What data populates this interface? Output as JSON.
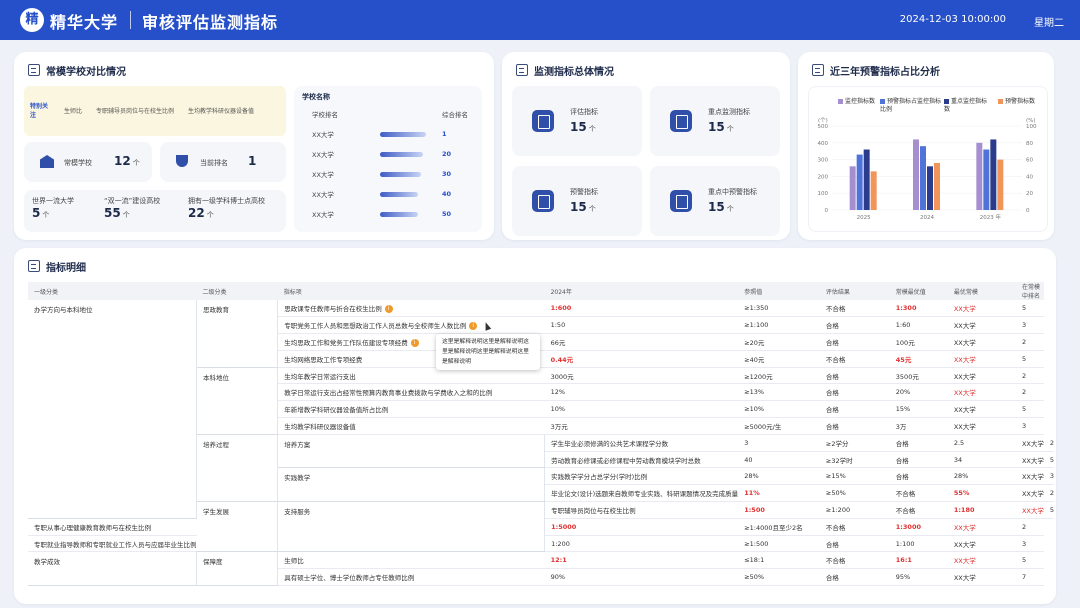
{
  "header": {
    "logo": "精",
    "university": "精华大学",
    "title": "审核评估监测指标",
    "datetime": "2024-12-03 10:00:00",
    "weekday": "星期二"
  },
  "compare": {
    "title": "常模学校对比情况",
    "tags": [
      "特别关注",
      "生师比",
      "专职辅导员岗位与在校生比例",
      "生均教学科研仪器设备值"
    ],
    "norm_label": "常模学校",
    "norm_value": "12",
    "norm_unit": "个",
    "rank_label": "当前排名",
    "rank_value": "1",
    "stats": [
      {
        "label": "世界一流大学",
        "value": "5",
        "unit": "个"
      },
      {
        "label": "“双一流”建设高校",
        "value": "55",
        "unit": "个"
      },
      {
        "label": "拥有一级学科博士点高校",
        "value": "22",
        "unit": "个"
      }
    ],
    "school_title": "学校名称",
    "rank_headers": [
      "学校排名",
      "综合排名"
    ],
    "rank_rows": [
      {
        "name": "XX大学",
        "score": 0.95,
        "rank": "1"
      },
      {
        "name": "XX大学",
        "score": 0.9,
        "rank": "20"
      },
      {
        "name": "XX大学",
        "score": 0.85,
        "rank": "30"
      },
      {
        "name": "XX大学",
        "score": 0.8,
        "rank": "40"
      },
      {
        "name": "XX大学",
        "score": 0.8,
        "rank": "50"
      }
    ]
  },
  "monitor": {
    "title": "监测指标总体情况",
    "cards": [
      {
        "label": "评估指标",
        "value": "15",
        "unit": "个",
        "icon": "clipboard-icon"
      },
      {
        "label": "重点监测指标",
        "value": "15",
        "unit": "个",
        "icon": "chart-monitor-icon"
      },
      {
        "label": "预警指标",
        "value": "15",
        "unit": "个",
        "icon": "alert-gauge-icon"
      },
      {
        "label": "重点中预警指标",
        "value": "15",
        "unit": "个",
        "icon": "layers-icon"
      }
    ]
  },
  "warning": {
    "title": "近三年预警指标占比分析"
  },
  "chart_data": {
    "type": "bar",
    "categories": [
      "2025",
      "2024",
      "2023"
    ],
    "xunit": "年",
    "yleft_unit": "(个)",
    "yright_unit": "(%)",
    "ylim": [
      0,
      500
    ],
    "yticks": [
      "500",
      "400",
      "300",
      "200",
      "100",
      "0"
    ],
    "yright_ticks": [
      "100",
      "80",
      "60",
      "40",
      "20",
      "0"
    ],
    "series": [
      {
        "name": "监控指标数",
        "color": "#a58fd0",
        "values": [
          260,
          420,
          400
        ]
      },
      {
        "name": "预警指标占监控指标比例",
        "color": "#4f73d9",
        "values": [
          330,
          380,
          360
        ]
      },
      {
        "name": "重点监控指标数",
        "color": "#2c3c8c",
        "values": [
          360,
          260,
          420
        ]
      },
      {
        "name": "预警指标数",
        "color": "#f0965a",
        "values": [
          230,
          280,
          300
        ]
      }
    ]
  },
  "details": {
    "title": "指标明细",
    "headers": [
      "一级分类",
      "二级分类",
      "指标项",
      "2024年",
      "参照值",
      "评估结果",
      "常模最优值",
      "最优常模",
      "在常模中排名"
    ],
    "tooltip": "这里是解释说明这里是解释说明这里是解释说明这里是解释说明这里是解释说明",
    "rows": [
      {
        "l1": "办学方向与本科地位",
        "s1": 13,
        "l2": "思政教育",
        "s2": 4,
        "item": "思政课专任教师与折合在校生比例",
        "info": "i",
        "y": "1:600",
        "yr": true,
        "ref": "≥1:350",
        "res": "不合格",
        "bad": true,
        "best": "1:300",
        "br": true,
        "bs": "XX大学",
        "bsr": true,
        "rank": "5"
      },
      {
        "item": "专职党务工作人员和思想政治工作人员总数与全校师生人数比例",
        "info": "i",
        "y": "1:50",
        "ref": "≥1:100",
        "res": "合格",
        "best": "1:60",
        "bs": "XX大学",
        "rank": "3"
      },
      {
        "item": "生均思政工作和党务工作队伍建设专项经费",
        "info": "i",
        "y": "66元",
        "ref": "≥20元",
        "res": "合格",
        "best": "100元",
        "bs": "XX大学",
        "rank": "2"
      },
      {
        "item": "生均网络思政工作专项经费",
        "y": "0.44元",
        "yr": true,
        "ref": "≥40元",
        "res": "不合格",
        "bad": true,
        "best": "45元",
        "br": true,
        "bs": "XX大学",
        "bsr": true,
        "rank": "5"
      },
      {
        "l2": "本科地位",
        "s2": 4,
        "item": "生均年教学日常运行支出",
        "y": "3000元",
        "ref": "≥1200元",
        "res": "合格",
        "best": "3500元",
        "bs": "XX大学",
        "rank": "2"
      },
      {
        "item": "教学日常运行支出占经常性预算内教育事业费拨款与学费收入之和的比例",
        "y": "12%",
        "ref": "≥13%",
        "res": "合格",
        "best": "20%",
        "bs": "XX大学",
        "bsr": true,
        "rank": "2"
      },
      {
        "item": "年新增教学科研仪器设备值所占比例",
        "y": "10%",
        "ref": "≥10%",
        "res": "合格",
        "best": "15%",
        "bs": "XX大学",
        "rank": "5"
      },
      {
        "item": "生均教学科研仪器设备值",
        "y": "3万元",
        "ref": "≥5000元/生",
        "res": "合格",
        "best": "3万",
        "bs": "XX大学",
        "rank": "3"
      },
      {
        "l1": "培养过程",
        "s1": 4,
        "l2": "培养方案",
        "s2": 2,
        "item": "学生毕业必须修满的公共艺术课程学分数",
        "y": "3",
        "ref": "≥2学分",
        "res": "合格",
        "best": "2.5",
        "bs": "XX大学",
        "rank": "2"
      },
      {
        "item": "劳动教育必修课或必修课程中劳动教育模块学时总数",
        "y": "40",
        "ref": "≥32学时",
        "res": "合格",
        "best": "34",
        "bs": "XX大学",
        "rank": "5"
      },
      {
        "l2": "实践教学",
        "s2": 2,
        "item": "实践教学学分占总学分(学时)比例",
        "y": "28%",
        "ref": "≥15%",
        "res": "合格",
        "best": "28%",
        "bs": "XX大学",
        "rank": "3"
      },
      {
        "item": "毕业论文(设计)选题来自教师专业实践、科研课题情况及完成质量",
        "y": "11%",
        "yr": true,
        "ref": "≥50%",
        "res": "不合格",
        "bad": true,
        "best": "55%",
        "br": true,
        "bs": "XX大学",
        "rank": "2"
      },
      {
        "l1": "学生发展",
        "s1": 3,
        "l2": "支持服务",
        "s2": 3,
        "item": "专职辅导员岗位与在校生比例",
        "y": "1:500",
        "yr": true,
        "ref": "≥1:200",
        "res": "不合格",
        "bad": true,
        "best": "1:180",
        "br": true,
        "bs": "XX大学",
        "bsr": true,
        "rank": "5"
      },
      {
        "item": "专职从事心理健康教育教师与在校生比例",
        "y": "1:5000",
        "yr": true,
        "ref": "≥1:4000且至少2名",
        "res": "不合格",
        "bad": true,
        "best": "1:3000",
        "br": true,
        "bs": "XX大学",
        "bsr": true,
        "rank": "2"
      },
      {
        "item": "专职就业指导教师和专职就业工作人员与应届毕业生比例",
        "y": "1:200",
        "ref": "≥1:500",
        "res": "合格",
        "best": "1:100",
        "bs": "XX大学",
        "rank": "3"
      },
      {
        "l1": "教学成效",
        "s1": 2,
        "l2": "保障度",
        "s2": 2,
        "item": "生师比",
        "y": "12:1",
        "yr": true,
        "ref": "≤18:1",
        "res": "不合格",
        "bad": true,
        "best": "16:1",
        "br": true,
        "bs": "XX大学",
        "bsr": true,
        "rank": "5"
      },
      {
        "item": "具有硕士学位、博士学位教师占专任教师比例",
        "y": "90%",
        "ref": "≥50%",
        "res": "合格",
        "best": "95%",
        "bs": "XX大学",
        "rank": "7"
      }
    ]
  }
}
